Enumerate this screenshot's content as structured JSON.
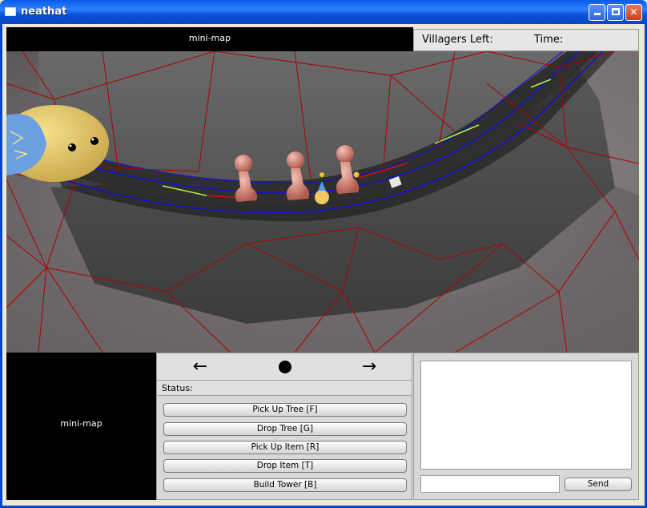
{
  "window": {
    "title": "neathat",
    "icon": "window-icon",
    "controls": [
      "minimize-icon",
      "maximize-icon",
      "close-icon"
    ]
  },
  "hud": {
    "minimap_label": "mini-map",
    "villagers_label": "Villagers Left:",
    "time_label": "Time:"
  },
  "minimap_bottom": {
    "label": "mini-map"
  },
  "controls": {
    "nav_left": "←",
    "nav_right": "→",
    "nav_center_icon": "dot-icon",
    "status_label": "Status:",
    "status_value": "",
    "actions": [
      {
        "label": "Pick Up Tree [F]"
      },
      {
        "label": "Drop Tree [G]"
      },
      {
        "label": "Pick Up Item [R]"
      },
      {
        "label": "Drop Item [T]"
      },
      {
        "label": "Build Tower [B]"
      }
    ]
  },
  "chat": {
    "log": "",
    "input_value": "",
    "send_label": "Send"
  },
  "colors": {
    "wireframe": "#b00000",
    "path_blue": "#1010d0",
    "path_green": "#a8f040",
    "road": "#2e2e2e",
    "rock": "#6c6c6c",
    "creature_body": "#e8c96c",
    "creature_blue": "#6aa0e0",
    "villager": "#d9857a"
  }
}
